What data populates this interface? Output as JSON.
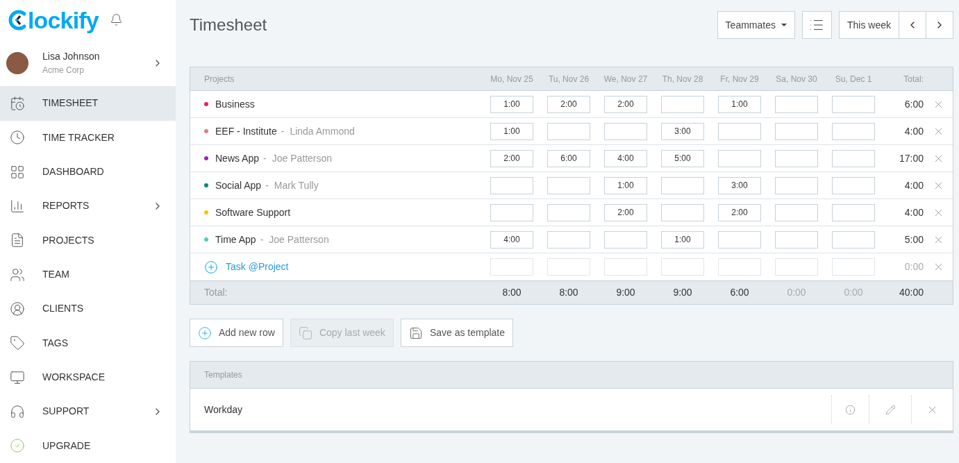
{
  "logo": {
    "text": "lockify"
  },
  "user": {
    "name": "Lisa Johnson",
    "company": "Acme Corp"
  },
  "nav": [
    {
      "label": "TIMESHEET",
      "selected": true,
      "submenu": false
    },
    {
      "label": "TIME TRACKER",
      "selected": false,
      "submenu": false
    },
    {
      "label": "DASHBOARD",
      "selected": false,
      "submenu": false
    },
    {
      "label": "REPORTS",
      "selected": false,
      "submenu": true
    },
    {
      "label": "PROJECTS",
      "selected": false,
      "submenu": false
    },
    {
      "label": "TEAM",
      "selected": false,
      "submenu": false
    },
    {
      "label": "CLIENTS",
      "selected": false,
      "submenu": false
    },
    {
      "label": "TAGS",
      "selected": false,
      "submenu": false
    },
    {
      "label": "WORKSPACE",
      "selected": false,
      "submenu": false
    },
    {
      "label": "SUPPORT",
      "selected": false,
      "submenu": true
    },
    {
      "label": "UPGRADE",
      "selected": false,
      "submenu": false
    }
  ],
  "page_title": "Timesheet",
  "toolbar": {
    "teammates": "Teammates",
    "range": "This week"
  },
  "table": {
    "project_header": "Projects",
    "days": [
      "Mo, Nov 25",
      "Tu, Nov 26",
      "We, Nov 27",
      "Th, Nov 28",
      "Fr, Nov 29",
      "Sa, Nov 30",
      "Su, Dec 1"
    ],
    "total_header": "Total:",
    "rows": [
      {
        "project": "Business",
        "client": null,
        "color": "#e91e63",
        "cells": [
          "1:00",
          "2:00",
          "2:00",
          null,
          "1:00",
          null,
          null
        ],
        "total": "6:00"
      },
      {
        "project": "EEF - Institute",
        "separator": "-",
        "client": "Linda Ammond",
        "color": "#d4877c",
        "cells": [
          "1:00",
          null,
          null,
          "3:00",
          null,
          null,
          null
        ],
        "total": "4:00"
      },
      {
        "project": "News App",
        "separator": "-",
        "client": "Joe Patterson",
        "color": "#9c27b0",
        "cells": [
          "2:00",
          "6:00",
          "4:00",
          "5:00",
          null,
          null,
          null
        ],
        "total": "17:00"
      },
      {
        "project": "Social App",
        "separator": "-",
        "client": "Mark Tully",
        "color": "#00897b",
        "cells": [
          null,
          null,
          "1:00",
          null,
          "3:00",
          null,
          null
        ],
        "total": "4:00"
      },
      {
        "project": "Software Support",
        "client": null,
        "color": "#ffc107",
        "cells": [
          null,
          null,
          "2:00",
          null,
          "2:00",
          null,
          null
        ],
        "total": "4:00"
      },
      {
        "project": "Time App",
        "separator": "-",
        "client": "Joe Patterson",
        "color": "#4dd0c4",
        "cells": [
          "4:00",
          null,
          null,
          "1:00",
          null,
          null,
          null
        ],
        "total": "5:00"
      }
    ],
    "new_row": {
      "placeholder": "Task @Project",
      "total": "0:00"
    },
    "totals": {
      "label": "Total:",
      "values": [
        {
          "text": "8:00",
          "dim": false
        },
        {
          "text": "8:00",
          "dim": false
        },
        {
          "text": "9:00",
          "dim": false
        },
        {
          "text": "9:00",
          "dim": false
        },
        {
          "text": "6:00",
          "dim": false
        },
        {
          "text": "0:00",
          "dim": true
        },
        {
          "text": "0:00",
          "dim": true
        }
      ],
      "grand": "40:00"
    }
  },
  "actions": [
    {
      "label": "Add new row",
      "disabled": false
    },
    {
      "label": "Copy last week",
      "disabled": true
    },
    {
      "label": "Save as template",
      "disabled": false
    }
  ],
  "templates": {
    "header": "Templates",
    "rows": [
      {
        "name": "Workday"
      }
    ]
  }
}
